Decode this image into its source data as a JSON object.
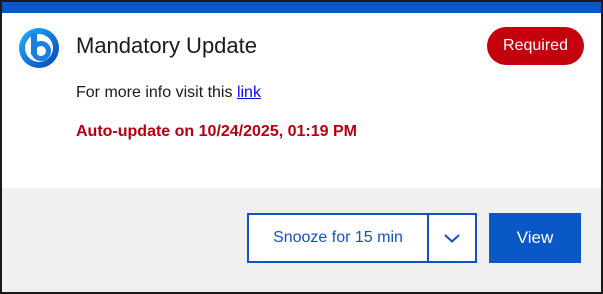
{
  "header": {
    "title": "Mandatory Update",
    "badge": "Required",
    "logo_icon": "brand-b-logo-icon"
  },
  "body": {
    "info_prefix": "For more info visit this",
    "info_link": "link",
    "auto_update": "Auto-update on 10/24/2025, 01:19 PM"
  },
  "footer": {
    "snooze_label": "Snooze for 15 min",
    "dropdown_icon": "chevron-down-icon",
    "view_label": "View"
  },
  "colors": {
    "accent": "#0a57c8",
    "required_badge": "#c4000d",
    "auto_update_text": "#b4000c",
    "link": "#0b0ef2",
    "footer_bg": "#f0f0f0"
  }
}
